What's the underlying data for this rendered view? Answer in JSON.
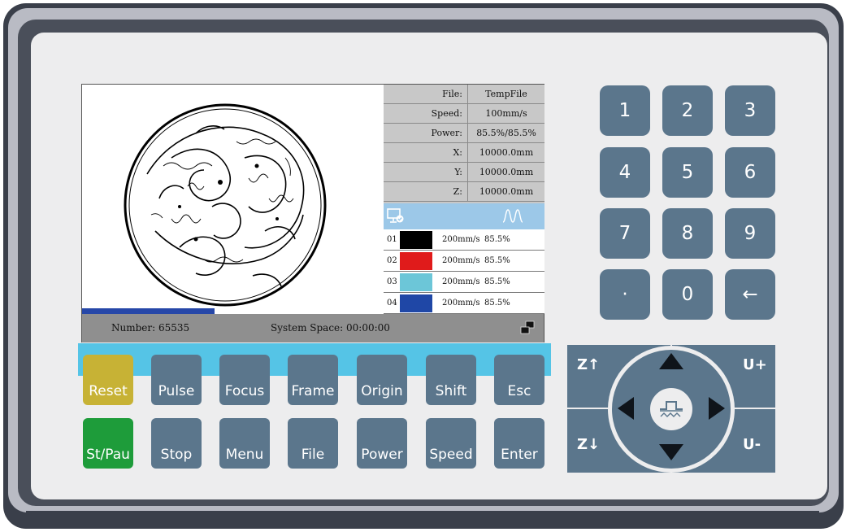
{
  "screen": {
    "params": [
      {
        "key": "File:",
        "value": "TempFile"
      },
      {
        "key": "Speed:",
        "value": "100mm/s"
      },
      {
        "key": "Power:",
        "value": "85.5%/85.5%"
      },
      {
        "key": "X:",
        "value": "10000.0mm"
      },
      {
        "key": "Y:",
        "value": "10000.0mm"
      },
      {
        "key": "Z:",
        "value": "10000.0mm"
      }
    ],
    "layers": [
      {
        "num": "01",
        "color": "#000000",
        "speed": "200mm/s",
        "power": "85.5%"
      },
      {
        "num": "02",
        "color": "#e01b1b",
        "speed": "200mm/s",
        "power": "85.5%"
      },
      {
        "num": "03",
        "color": "#6cc6d8",
        "speed": "200mm/s",
        "power": "85.5%"
      },
      {
        "num": "04",
        "color": "#1f47a6",
        "speed": "200mm/s",
        "power": "85.5%"
      }
    ],
    "layer_header_icons": [
      "monitor-check-icon",
      "waveform-icon"
    ],
    "progress_fraction": 0.44,
    "status": {
      "number": "Number: 65535",
      "system_space": "System Space: 00:00:00",
      "icon": "network-icon"
    }
  },
  "function_keys": {
    "row1": [
      "Reset",
      "Pulse",
      "Focus",
      "Frame",
      "Origin",
      "Shift",
      "Esc"
    ],
    "row2": [
      "St/Pau",
      "Stop",
      "Menu",
      "File",
      "Power",
      "Speed",
      "Enter"
    ]
  },
  "numpad": {
    "keys": [
      "1",
      "2",
      "3",
      "4",
      "5",
      "6",
      "7",
      "8",
      "9",
      "·",
      "0",
      "←"
    ]
  },
  "dpad": {
    "z_up": "Z↑",
    "z_down": "Z↓",
    "u_plus": "U+",
    "u_minus": "U-",
    "center_icon": "laser-pulse-icon"
  },
  "colors": {
    "key_blue": "#5b768c",
    "reset_yellow": "#c7b235",
    "start_green": "#1e9c3a",
    "strip_cyan": "#55c4e6",
    "layer_header": "#9cc8e8"
  }
}
